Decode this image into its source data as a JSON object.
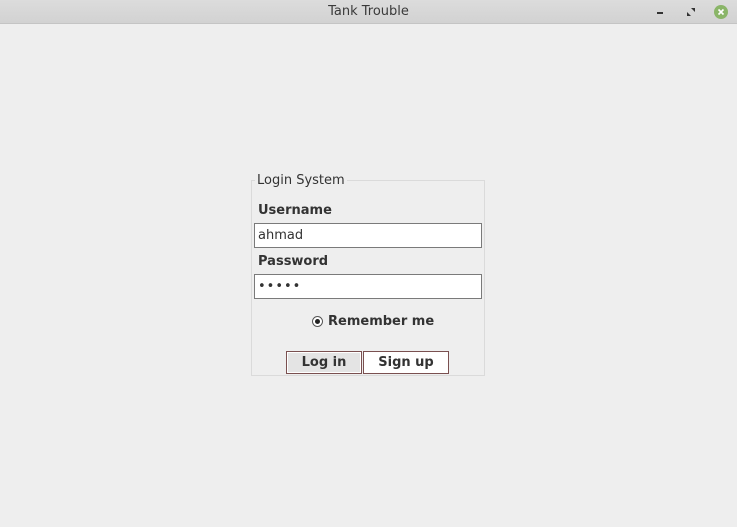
{
  "window": {
    "title": "Tank Trouble",
    "controls": {
      "minimize": "minimize",
      "maximize": "maximize",
      "close": "close"
    }
  },
  "login": {
    "group_title": "Login System",
    "username_label": "Username",
    "username_value": "ahmad",
    "password_label": "Password",
    "password_value": "•••••",
    "remember_label": "Remember me",
    "remember_checked": true,
    "login_button": "Log in",
    "signup_button": "Sign up"
  },
  "colors": {
    "close_button": "#8ab568",
    "background": "#eeeeee"
  }
}
